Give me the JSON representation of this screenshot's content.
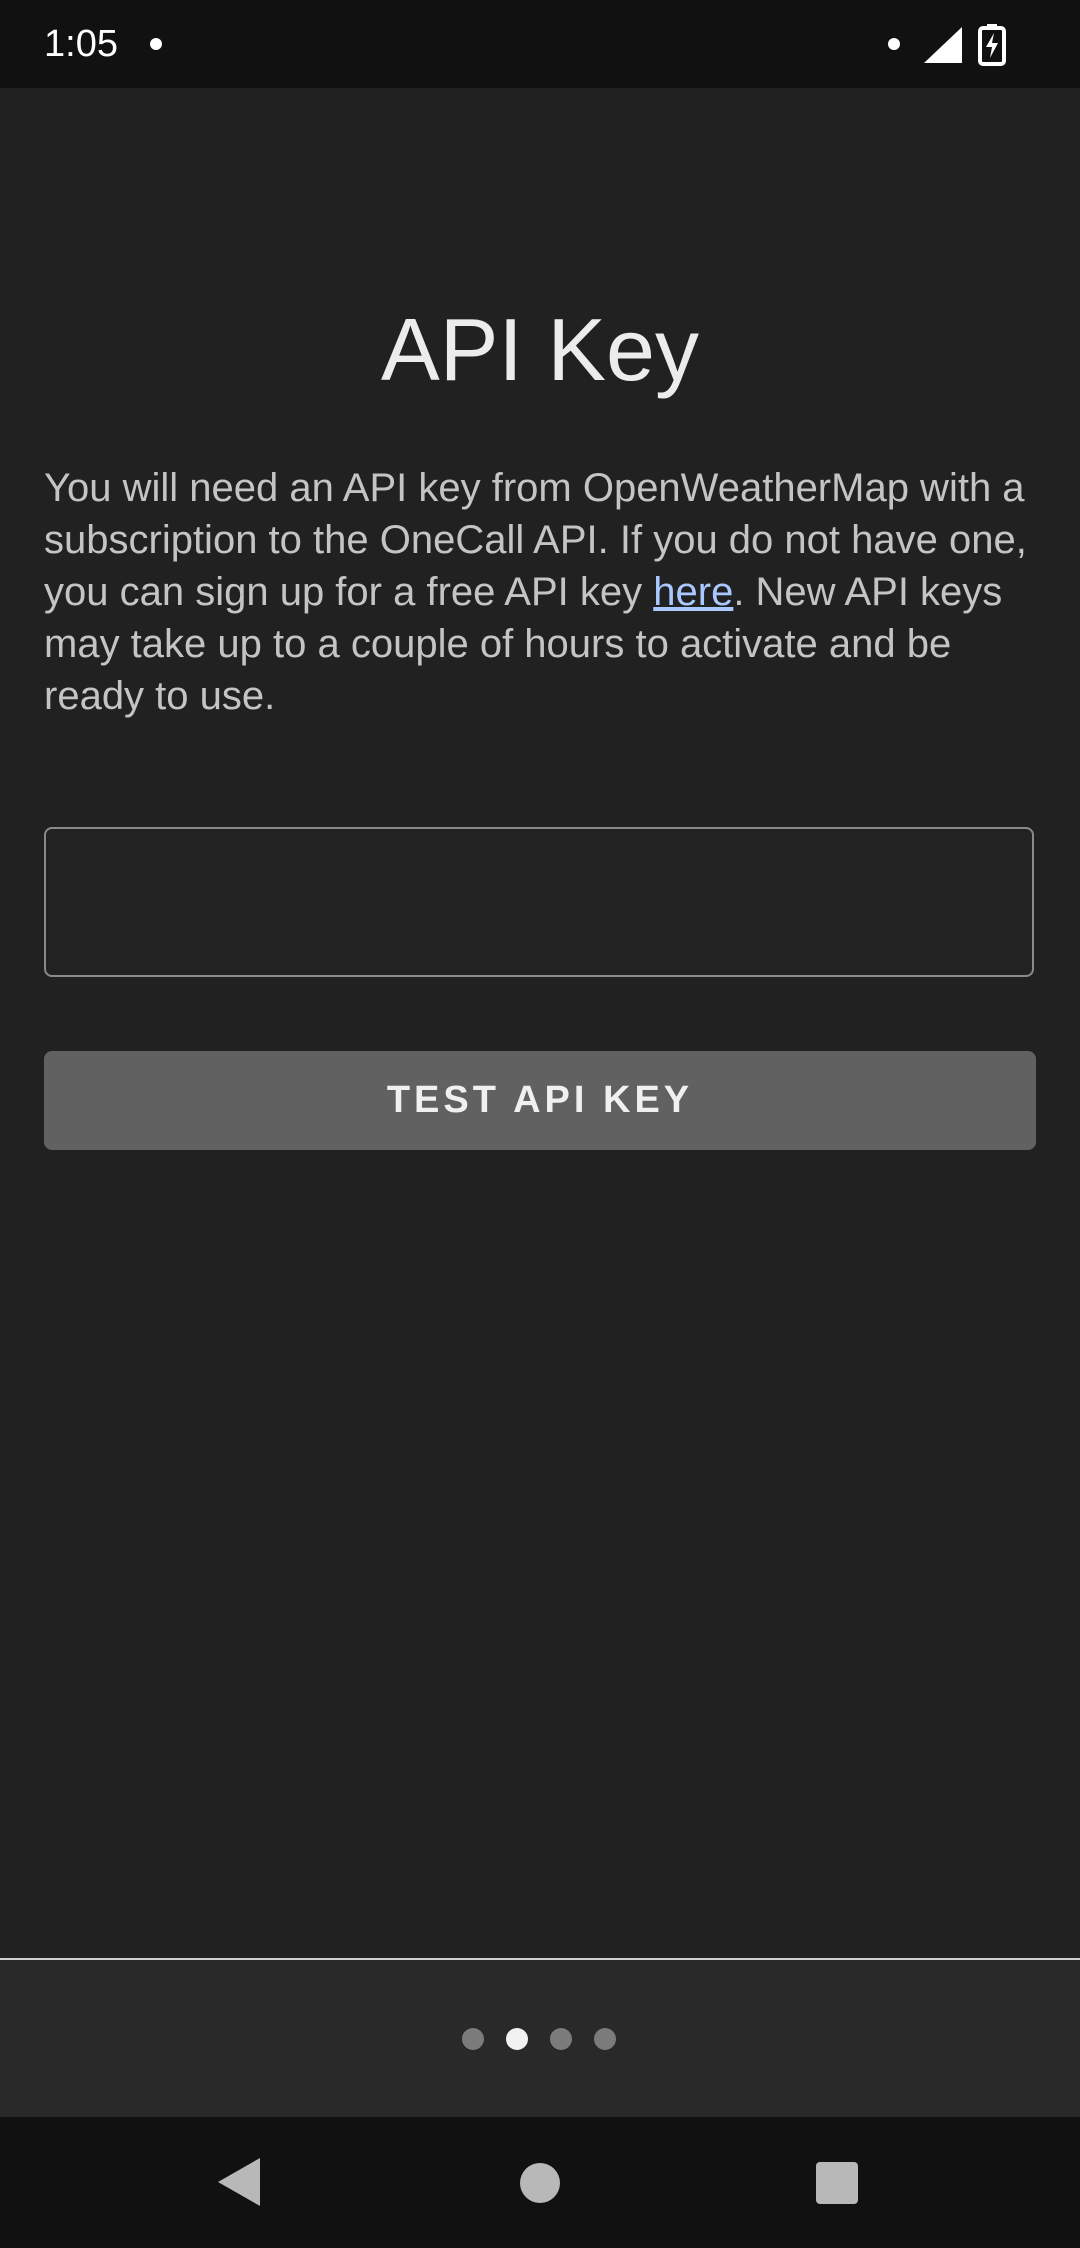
{
  "status_bar": {
    "time": "1:05"
  },
  "main": {
    "title": "API Key",
    "description_before_link": "You will need an API key from OpenWeatherMap with a subscription to the OneCall API. If you do not have one, you can sign up for a free API key ",
    "link_text": "here",
    "description_after_link": ". New API keys may take up to a couple of hours to activate and be ready to use.",
    "api_key_input": {
      "value": "",
      "placeholder": ""
    },
    "test_button_label": "TEST API KEY"
  },
  "pager": {
    "page_count": 4,
    "active_index": 1
  },
  "colors": {
    "background": "#212121",
    "status_bar": "#111111",
    "button": "#616161",
    "link": "#a9c8ff"
  },
  "icons": {
    "status_left": "notification-dot-icon",
    "status_right": [
      "notification-dot-icon",
      "cell-signal-icon",
      "battery-charging-icon"
    ],
    "nav": [
      "back-icon",
      "home-icon",
      "recents-icon"
    ]
  }
}
